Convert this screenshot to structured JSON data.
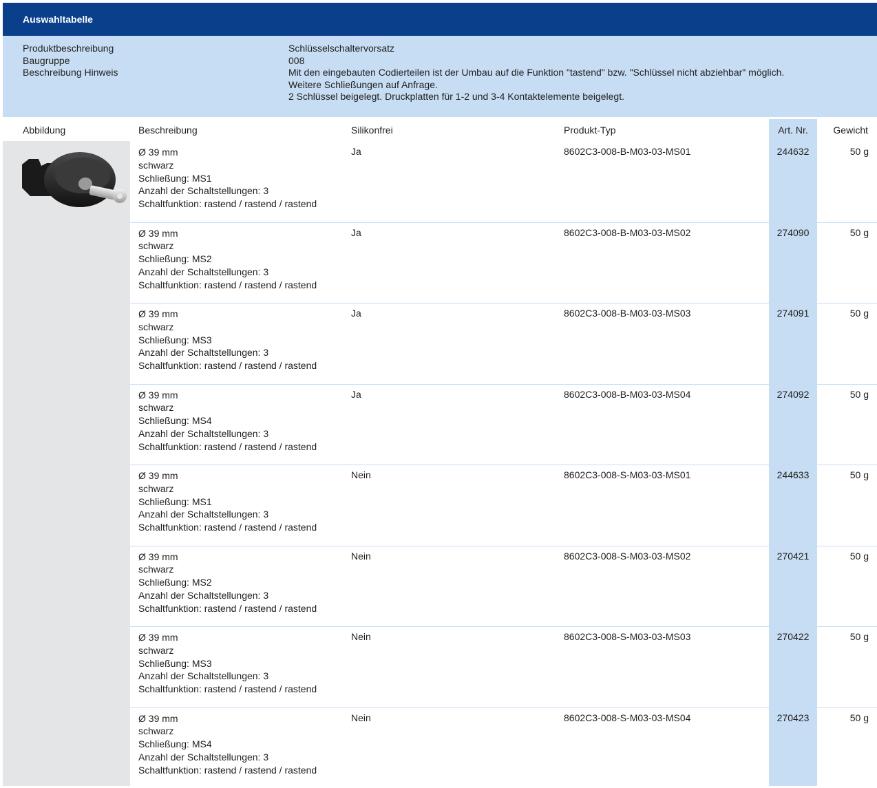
{
  "header": {
    "title": "Auswahltabelle"
  },
  "info": {
    "labels": [
      "Produktbeschreibung",
      "Baugruppe",
      "Beschreibung Hinweis"
    ],
    "values": [
      "Schlüsselschaltervorsatz",
      "008",
      "Mit den eingebauten Codierteilen ist der Umbau auf die Funktion \"tastend\" bzw. \"Schlüssel nicht abziehbar\" möglich.",
      "Weitere Schließungen auf Anfrage.",
      "2 Schlüssel beigelegt. Druckplatten für 1-2 und 3-4 Kontaktelemente beigelegt."
    ]
  },
  "columns": {
    "abbildung": "Abbildung",
    "beschreibung": "Beschreibung",
    "silikonfrei": "Silikonfrei",
    "produkttyp": "Produkt-Typ",
    "artnr": "Art. Nr.",
    "gewicht": "Gewicht"
  },
  "product_image": {
    "icon": "key-switch-image"
  },
  "rows": [
    {
      "desc": [
        "Ø 39 mm",
        "schwarz",
        "Schließung: MS1",
        "Anzahl der Schaltstellungen: 3",
        "Schaltfunktion: rastend / rastend / rastend"
      ],
      "silikonfrei": "Ja",
      "typ": "8602C3-008-B-M03-03-MS01",
      "art": "244632",
      "gewicht": "50 g"
    },
    {
      "desc": [
        "Ø 39 mm",
        "schwarz",
        "Schließung: MS2",
        "Anzahl der Schaltstellungen: 3",
        "Schaltfunktion: rastend / rastend / rastend"
      ],
      "silikonfrei": "Ja",
      "typ": "8602C3-008-B-M03-03-MS02",
      "art": "274090",
      "gewicht": "50 g"
    },
    {
      "desc": [
        "Ø 39 mm",
        "schwarz",
        "Schließung: MS3",
        "Anzahl der Schaltstellungen: 3",
        "Schaltfunktion: rastend / rastend / rastend"
      ],
      "silikonfrei": "Ja",
      "typ": "8602C3-008-B-M03-03-MS03",
      "art": "274091",
      "gewicht": "50 g"
    },
    {
      "desc": [
        "Ø 39 mm",
        "schwarz",
        "Schließung: MS4",
        "Anzahl der Schaltstellungen: 3",
        "Schaltfunktion: rastend / rastend / rastend"
      ],
      "silikonfrei": "Ja",
      "typ": "8602C3-008-B-M03-03-MS04",
      "art": "274092",
      "gewicht": "50 g"
    },
    {
      "desc": [
        "Ø 39 mm",
        "schwarz",
        "Schließung: MS1",
        "Anzahl der Schaltstellungen: 3",
        "Schaltfunktion: rastend / rastend / rastend"
      ],
      "silikonfrei": "Nein",
      "typ": "8602C3-008-S-M03-03-MS01",
      "art": "244633",
      "gewicht": "50 g"
    },
    {
      "desc": [
        "Ø 39 mm",
        "schwarz",
        "Schließung: MS2",
        "Anzahl der Schaltstellungen: 3",
        "Schaltfunktion: rastend / rastend / rastend"
      ],
      "silikonfrei": "Nein",
      "typ": "8602C3-008-S-M03-03-MS02",
      "art": "270421",
      "gewicht": "50 g"
    },
    {
      "desc": [
        "Ø 39 mm",
        "schwarz",
        "Schließung: MS3",
        "Anzahl der Schaltstellungen: 3",
        "Schaltfunktion: rastend / rastend / rastend"
      ],
      "silikonfrei": "Nein",
      "typ": "8602C3-008-S-M03-03-MS03",
      "art": "270422",
      "gewicht": "50 g"
    },
    {
      "desc": [
        "Ø 39 mm",
        "schwarz",
        "Schließung: MS4",
        "Anzahl der Schaltstellungen: 3",
        "Schaltfunktion: rastend / rastend / rastend"
      ],
      "silikonfrei": "Nein",
      "typ": "8602C3-008-S-M03-03-MS04",
      "art": "270423",
      "gewicht": "50 g"
    }
  ]
}
